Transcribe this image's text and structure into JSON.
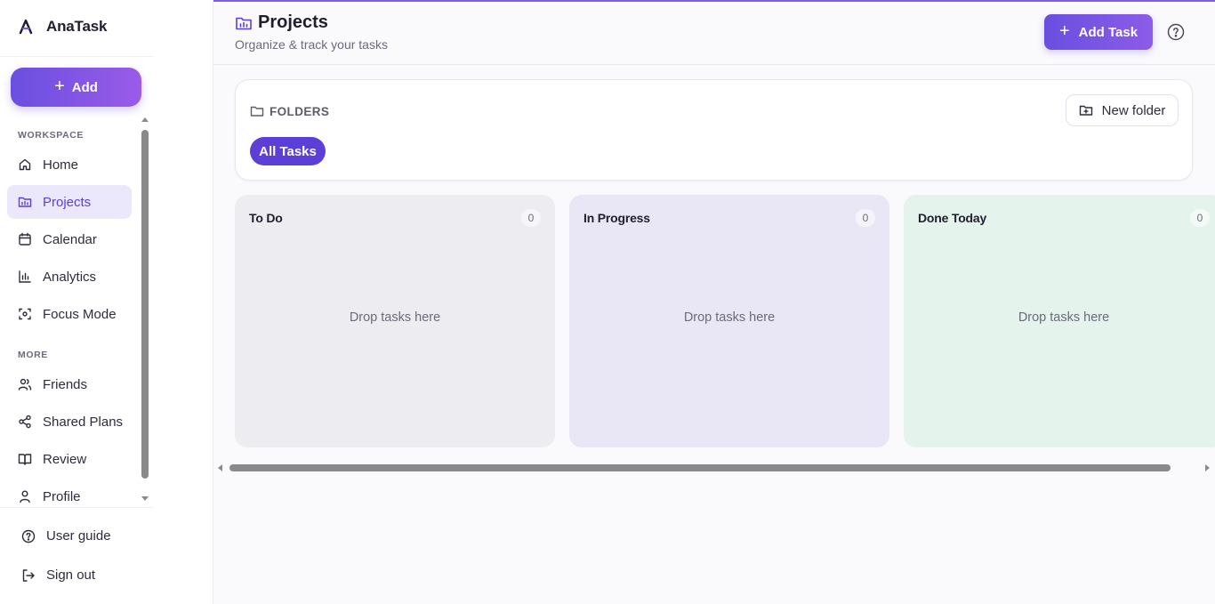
{
  "app": {
    "name": "AnaTask"
  },
  "sidebar": {
    "add_label": "Add",
    "workspace_label": "WORKSPACE",
    "workspace_items": [
      {
        "label": "Home",
        "icon": "home-icon"
      },
      {
        "label": "Projects",
        "icon": "folder-icon",
        "active": true
      },
      {
        "label": "Calendar",
        "icon": "calendar-icon"
      },
      {
        "label": "Analytics",
        "icon": "bar-chart-icon"
      },
      {
        "label": "Focus Mode",
        "icon": "focus-icon"
      }
    ],
    "more_label": "MORE",
    "more_items": [
      {
        "label": "Friends",
        "icon": "users-icon"
      },
      {
        "label": "Shared Plans",
        "icon": "share-icon"
      },
      {
        "label": "Review",
        "icon": "book-icon"
      },
      {
        "label": "Profile",
        "icon": "user-icon"
      }
    ],
    "bottom_items": [
      {
        "label": "User guide",
        "icon": "help-circle-icon"
      },
      {
        "label": "Sign out",
        "icon": "logout-icon"
      }
    ]
  },
  "header": {
    "title": "Projects",
    "subtitle": "Organize & track your tasks",
    "add_task_label": "Add Task"
  },
  "folders": {
    "label": "FOLDERS",
    "new_folder_label": "New folder",
    "chips": [
      {
        "label": "All Tasks",
        "selected": true
      }
    ]
  },
  "board": {
    "columns": [
      {
        "title": "To Do",
        "count": "0",
        "empty_text": "Drop tasks here",
        "color": "#ececf1"
      },
      {
        "title": "In Progress",
        "count": "0",
        "empty_text": "Drop tasks here",
        "color": "#e9e6f5"
      },
      {
        "title": "Done Today",
        "count": "0",
        "empty_text": "Drop tasks here",
        "color": "#e4f3ec"
      }
    ]
  },
  "colors": {
    "accent": "#5b3fd6",
    "accent_gradient_end": "#9a5be8"
  }
}
